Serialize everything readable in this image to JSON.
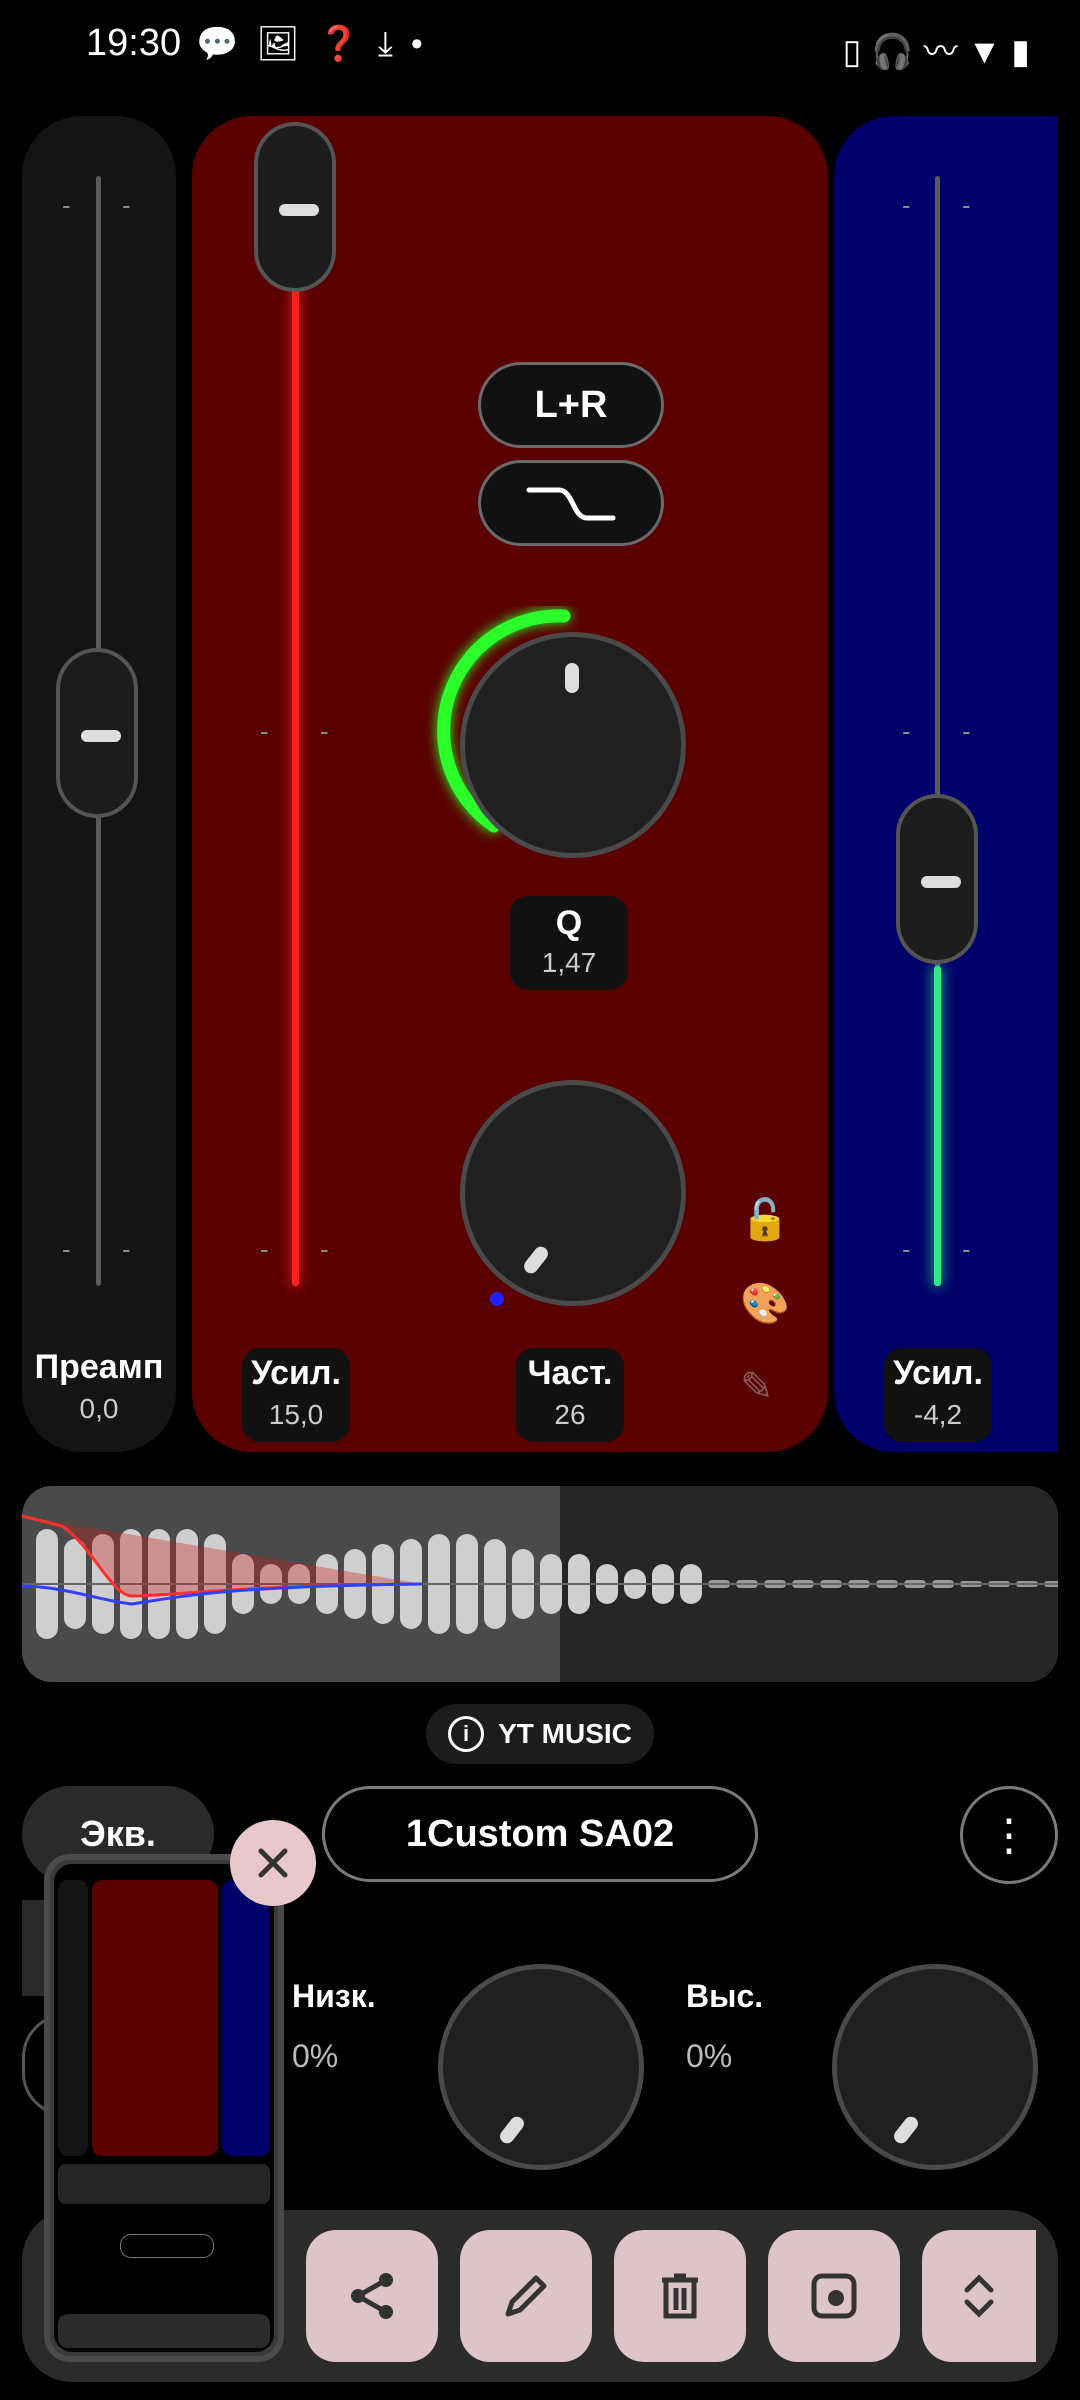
{
  "status_bar": {
    "time": "19:30",
    "left_icons": [
      "chat-icon",
      "image-icon",
      "help-icon",
      "download-icon",
      "dot-icon"
    ],
    "right_icons": [
      "phone-icon",
      "headphones-icon",
      "nfc-icon",
      "vibrate-icon",
      "wifi-icon",
      "signal-hd-icon",
      "signal-hd-icon",
      "battery-icon"
    ]
  },
  "preamp": {
    "title": "Преамп",
    "value": "0,0",
    "level": 0.5
  },
  "band_active": {
    "gain_title": "Усил.",
    "gain_value": "15,0",
    "channel_label": "L+R",
    "filter_icon": "low-shelf-icon",
    "q_title": "Q",
    "q_value": "1,47",
    "freq_title": "Част.",
    "freq_value": "26",
    "color": "#5a0000",
    "gain_fill_color": "#ff2020",
    "q_ring_color": "#2aff2a"
  },
  "band_next": {
    "gain_title": "Усил.",
    "gain_value": "-4,2",
    "color": "#00006a",
    "fill_color": "#2ee88a"
  },
  "side_icons": [
    "lock-open-icon",
    "palette-icon",
    "pencil-icon"
  ],
  "source": {
    "label": "YT MUSIC"
  },
  "tabs": {
    "eq": "Экв."
  },
  "preset": {
    "name": "1Custom SA02"
  },
  "dials": {
    "low": {
      "title": "Низк.",
      "value": "0%"
    },
    "high": {
      "title": "Выс.",
      "value": "0%"
    }
  },
  "actions": [
    "share-icon",
    "edit-icon",
    "delete-icon",
    "screenshot-icon",
    "expand-icon"
  ]
}
